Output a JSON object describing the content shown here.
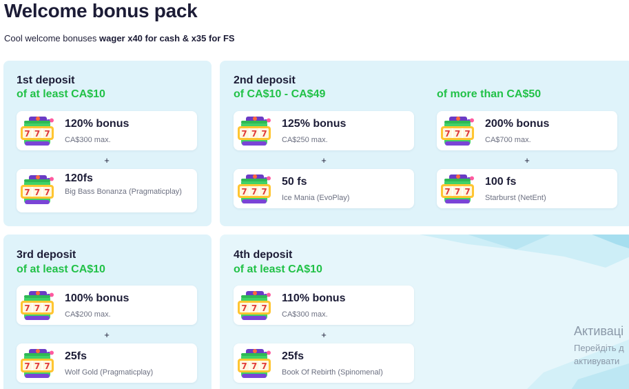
{
  "header": {
    "title": "Welcome bonus pack",
    "subtitle_plain": "Cool welcome bonuses",
    "subtitle_bold": "wager x40 for cash & x35 for FS"
  },
  "plus_sign": "+",
  "deposits": {
    "d1": {
      "title": "1st deposit",
      "condition": "of at least  CA$10",
      "bonus": {
        "main": "120% bonus",
        "sub": "CA$300 max."
      },
      "spins": {
        "main": "120fs",
        "sub": "Big Bass Bonanza (Pragmaticplay)"
      }
    },
    "d2a": {
      "title": "2nd deposit",
      "condition": "of CA$10 - CA$49",
      "bonus": {
        "main": "125% bonus",
        "sub": "CA$250 max."
      },
      "spins": {
        "main": "50 fs",
        "sub": "Ice Mania (EvoPlay)"
      }
    },
    "d2b": {
      "condition": "of more than CA$50",
      "bonus": {
        "main": "200% bonus",
        "sub": "CA$700 max."
      },
      "spins": {
        "main": "100 fs",
        "sub": "Starburst (NetEnt)"
      }
    },
    "d3": {
      "title": "3rd deposit",
      "condition": "of at least CA$10",
      "bonus": {
        "main": "100% bonus",
        "sub": "CA$200 max."
      },
      "spins": {
        "main": "25fs",
        "sub": "Wolf Gold (Pragmaticplay)"
      }
    },
    "d4": {
      "title": "4th deposit",
      "condition": "of at least CA$10",
      "bonus": {
        "main": "110% bonus",
        "sub": "CA$300 max."
      },
      "spins": {
        "main": "25fs",
        "sub": "Book Of Rebirth (Spinomenal)"
      }
    }
  },
  "os_overlay": {
    "line1": "Активаці",
    "line2": "Перейдіть д",
    "line3": "активувати"
  },
  "colors": {
    "title": "#1c1c36",
    "green": "#21c147",
    "card_bg": "#dff3fa",
    "muted": "#6b6f80"
  }
}
